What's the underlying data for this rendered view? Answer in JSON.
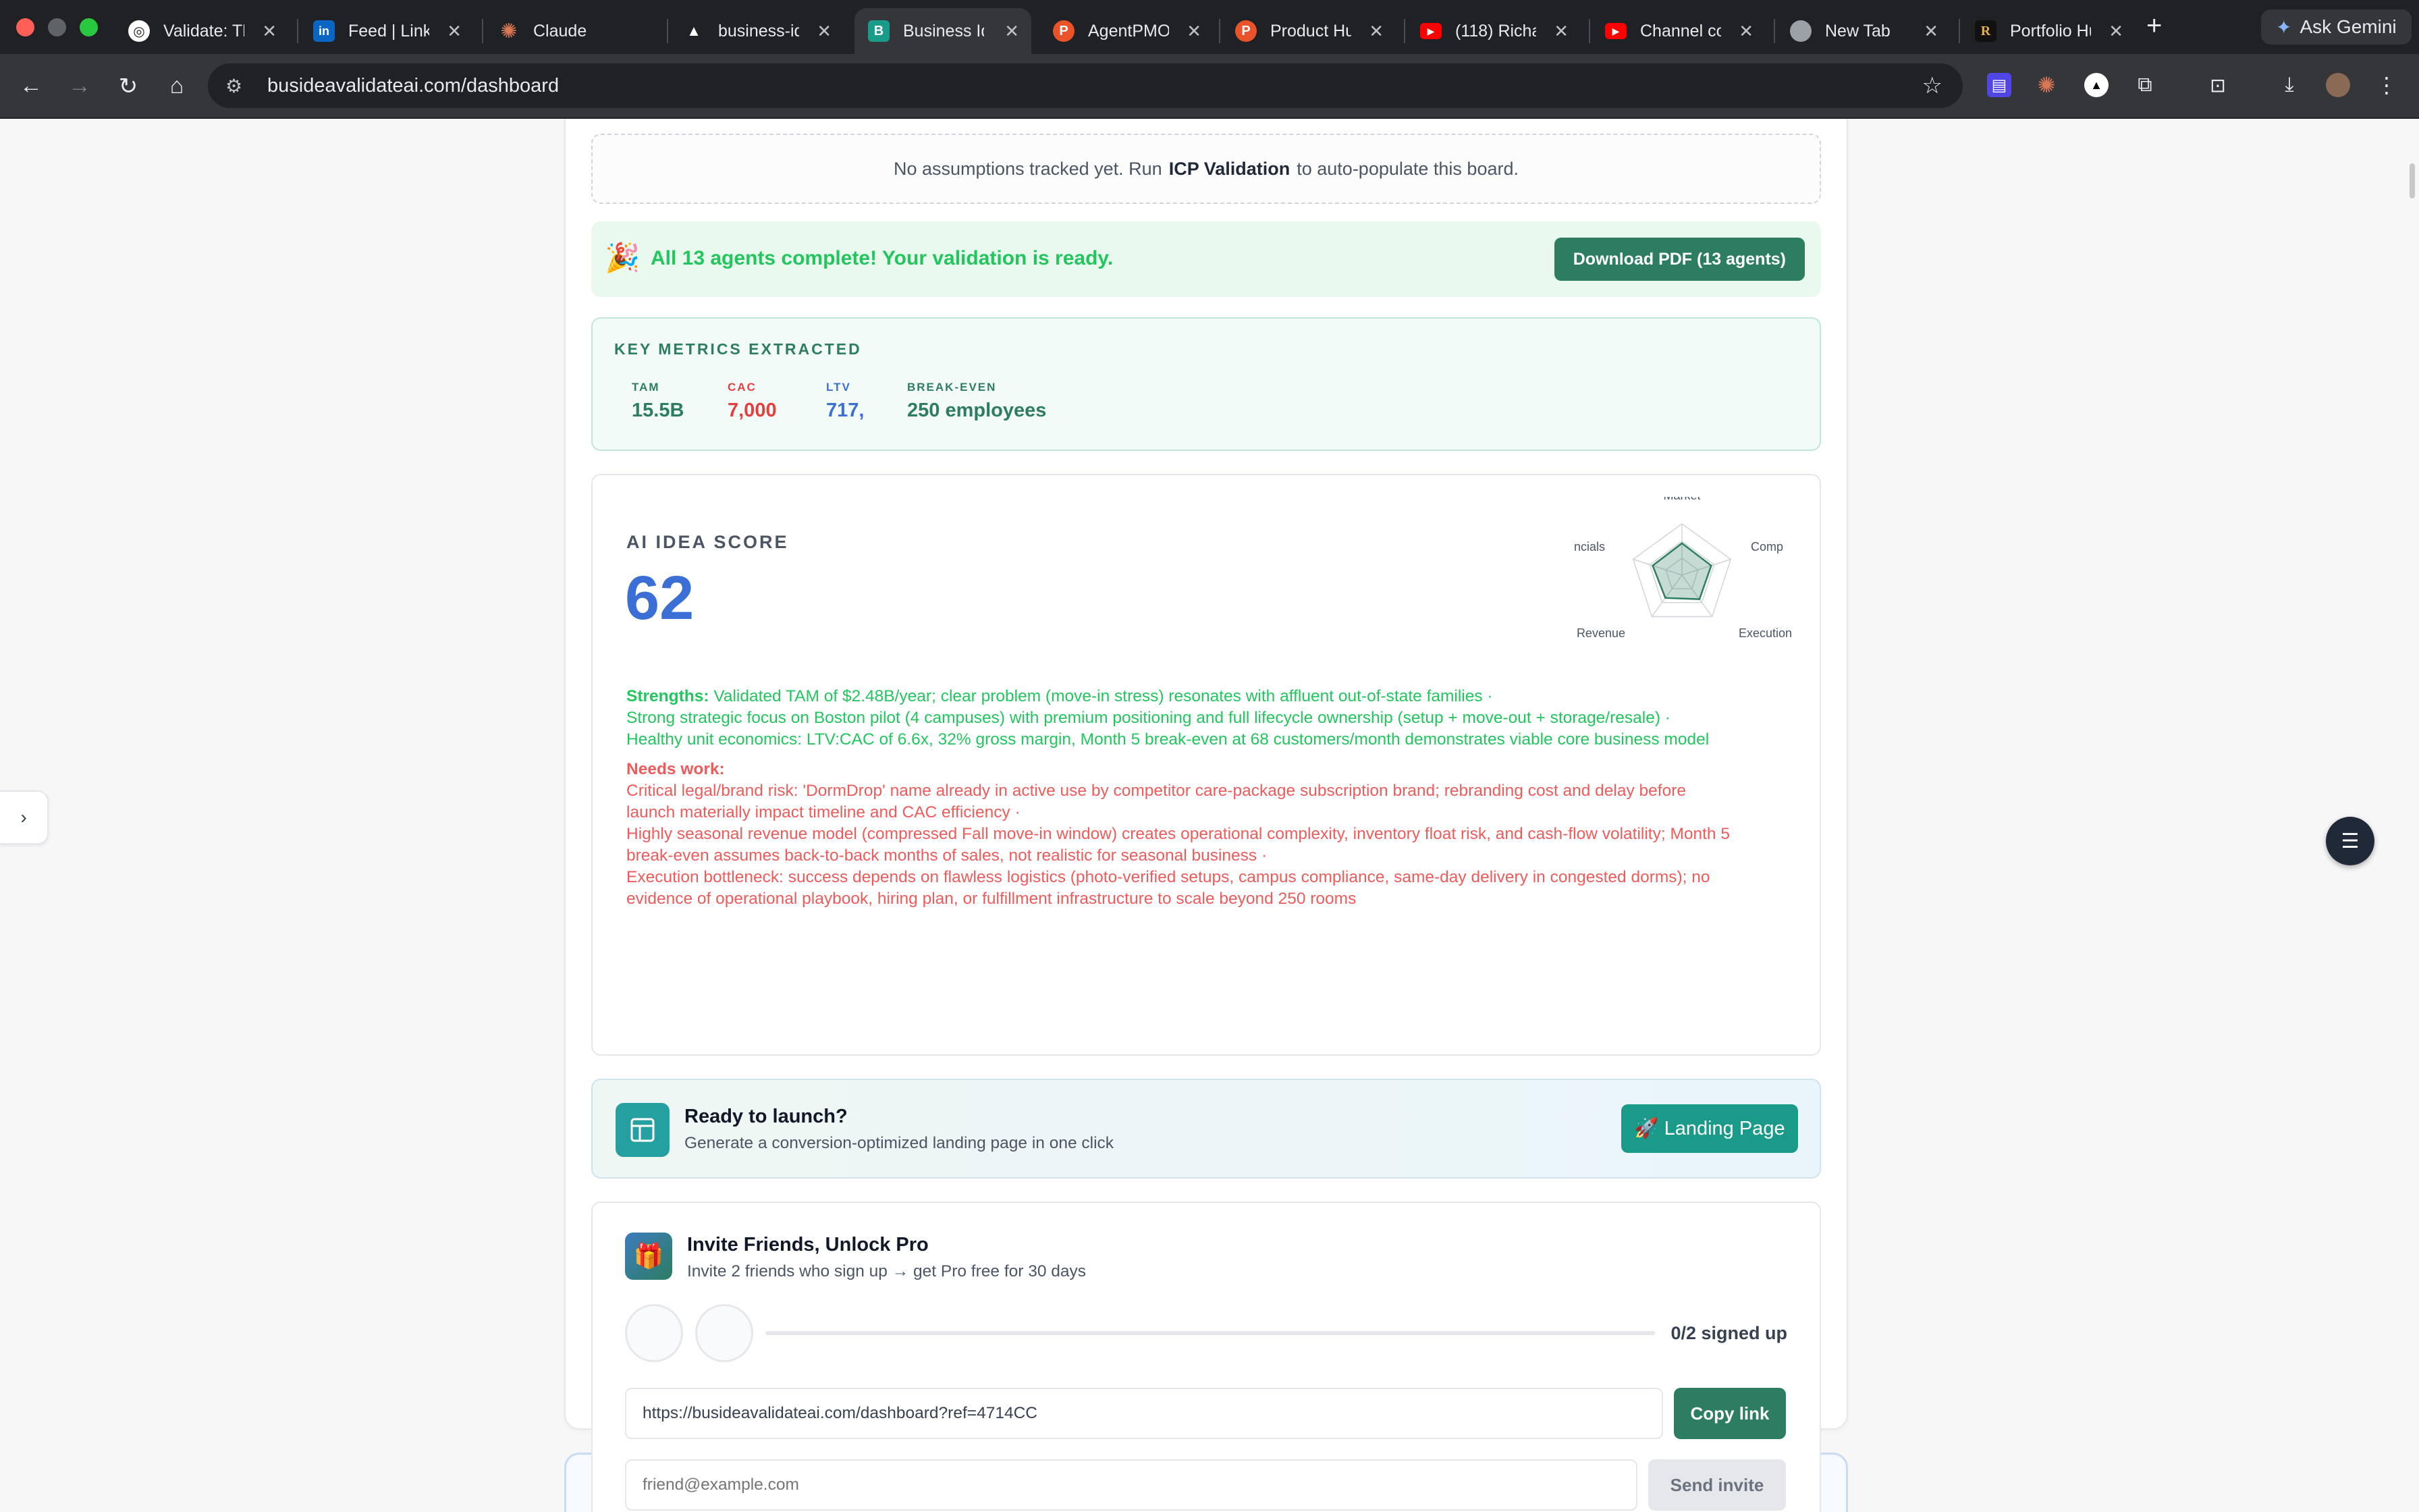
{
  "browser": {
    "tabs": [
      {
        "label": "Validate: Th",
        "icon": "validate-icon",
        "color": "#ffffff"
      },
      {
        "label": "Feed | Linke",
        "icon": "linkedin-icon",
        "color": "#0a66c2"
      },
      {
        "label": "Claude",
        "icon": "claude-icon",
        "color": "#d97757"
      },
      {
        "label": "business-id",
        "icon": "vercel-icon",
        "color": "#000000"
      },
      {
        "label": "Business Id",
        "icon": "business-idea-icon",
        "color": "#1a9b8a"
      },
      {
        "label": "AgentPMO",
        "icon": "producthunt-icon",
        "color": "#ea532a"
      },
      {
        "label": "Product Hu",
        "icon": "producthunt-icon",
        "color": "#ea532a"
      },
      {
        "label": "(118) Richa",
        "icon": "youtube-icon",
        "color": "#ff0000"
      },
      {
        "label": "Channel co",
        "icon": "youtube-icon",
        "color": "#ff0000"
      },
      {
        "label": "New Tab",
        "icon": "chrome-icon",
        "color": "#9aa0a6"
      },
      {
        "label": "Portfolio Hu",
        "icon": "portfolio-icon",
        "color": "#111111"
      }
    ],
    "gemini_label": "Ask Gemini",
    "url": "busideavalidateai.com/dashboard"
  },
  "assumptions": {
    "prefix": "No assumptions tracked yet. Run",
    "emphasis": "ICP Validation",
    "suffix": "to auto-populate this board."
  },
  "complete_banner": {
    "message": "All 13 agents complete! Your validation is ready.",
    "download_label": "Download PDF (13 agents)"
  },
  "key_metrics": {
    "title": "KEY METRICS EXTRACTED",
    "items": [
      {
        "label": "TAM",
        "value": "15.5B",
        "color": "#2d7d62"
      },
      {
        "label": "CAC",
        "value": "7,000",
        "color": "#e53e3e"
      },
      {
        "label": "LTV",
        "value": "717,",
        "color": "#3b6fd6"
      },
      {
        "label": "BREAK-EVEN",
        "value": "250 employees",
        "color": "#2d7d62"
      }
    ]
  },
  "idea_score": {
    "title": "AI IDEA SCORE",
    "score": "62",
    "radar_labels": [
      "Market",
      "Comp",
      "Execution",
      "Revenue",
      "ncials"
    ],
    "radar_values": [
      0.62,
      0.6,
      0.58,
      0.55,
      0.6
    ],
    "strengths_label": "Strengths:",
    "strengths": [
      "Validated TAM of $2.48B/year; clear problem (move-in stress) resonates with affluent out-of-state families ·",
      "Strong strategic focus on Boston pilot (4 campuses) with premium positioning and full lifecycle ownership (setup + move-out + storage/resale) ·",
      "Healthy unit economics: LTV:CAC of 6.6x, 32% gross margin, Month 5 break-even at 68 customers/month demonstrates viable core business model"
    ],
    "needs_work_label": "Needs work:",
    "needs_work": [
      "Critical legal/brand risk: 'DormDrop' name already in active use by competitor care-package subscription brand; rebranding cost and delay before",
      "launch materially impact timeline and CAC efficiency ·",
      "Highly seasonal revenue model (compressed Fall move-in window) creates operational complexity, inventory float risk, and cash-flow volatility; Month 5",
      "break-even assumes back-to-back months of sales, not realistic for seasonal business ·",
      "Execution bottleneck: success depends on flawless logistics (photo-verified setups, campus compliance, same-day delivery in congested dorms); no",
      "evidence of operational playbook, hiring plan, or fulfillment infrastructure to scale beyond 250 rooms"
    ]
  },
  "launch": {
    "title": "Ready to launch?",
    "subtitle": "Generate a conversion-optimized landing page in one click",
    "button_label": "🚀 Landing Page"
  },
  "invite": {
    "title": "Invite Friends, Unlock Pro",
    "subtitle": "Invite 2 friends who sign up → get Pro free for 30 days",
    "progress": 0,
    "count_label": "0/2 signed up",
    "referral_link": "https://busideavalidateai.com/dashboard?ref=4714CC",
    "copy_label": "Copy link",
    "email_placeholder": "friend@example.com",
    "send_label": "Send invite"
  }
}
